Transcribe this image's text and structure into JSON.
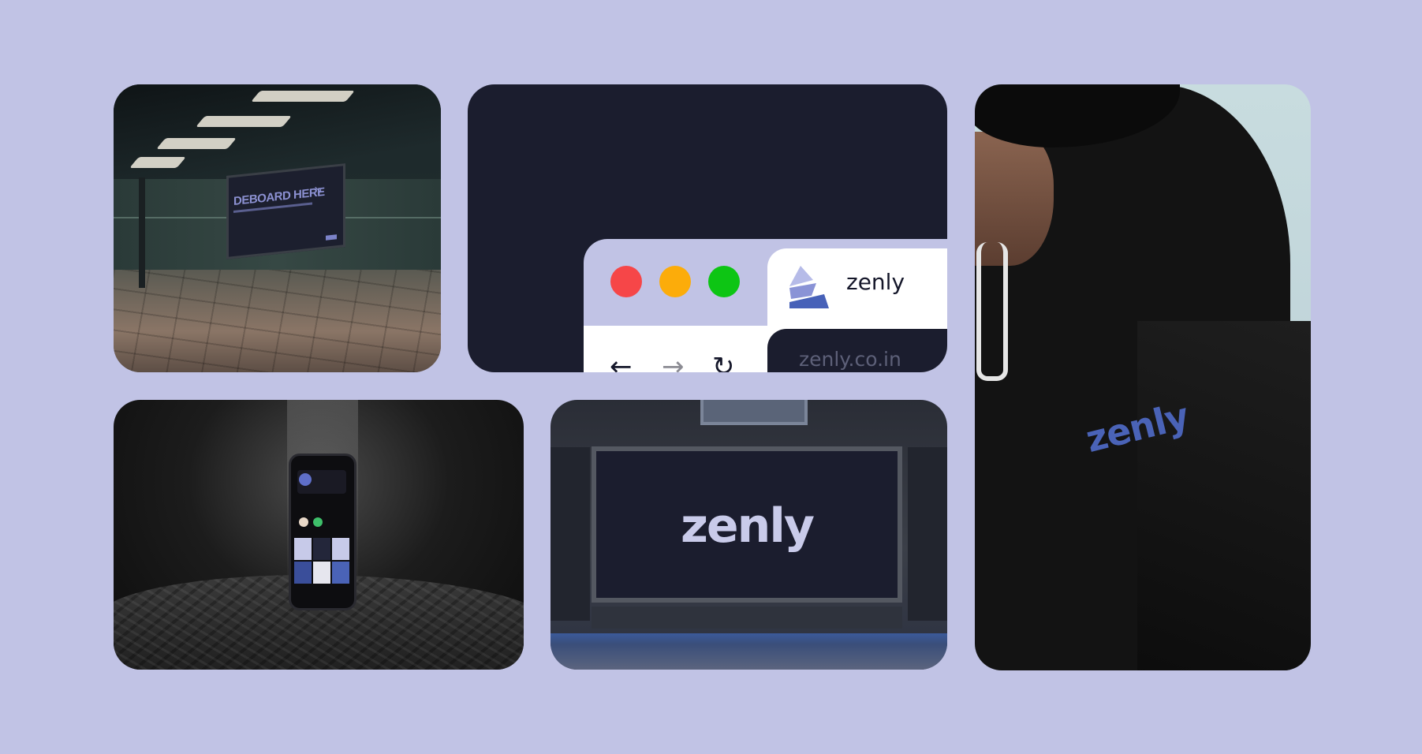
{
  "station": {
    "billboard_title": "DEBOARD HERE",
    "billboard_arrow": "↘"
  },
  "browser": {
    "window_buttons": [
      {
        "name": "close",
        "color": "#f64648"
      },
      {
        "name": "minimize",
        "color": "#fcac0a"
      },
      {
        "name": "maximize",
        "color": "#0dc514"
      }
    ],
    "tab_title": "zenly",
    "back_glyph": "←",
    "forward_glyph": "→",
    "reload_glyph": "↻",
    "url": "zenly.co.in",
    "logo_colors": [
      "#8a93d6",
      "#4761b8"
    ]
  },
  "hoodie": {
    "logo_text": "zenly",
    "logo_color": "#4a63b7"
  },
  "board": {
    "logo_text": "zenly"
  },
  "colors": {
    "background": "#c1c3e5",
    "navy": "#1b1d2e",
    "accent": "#8c91d2"
  }
}
